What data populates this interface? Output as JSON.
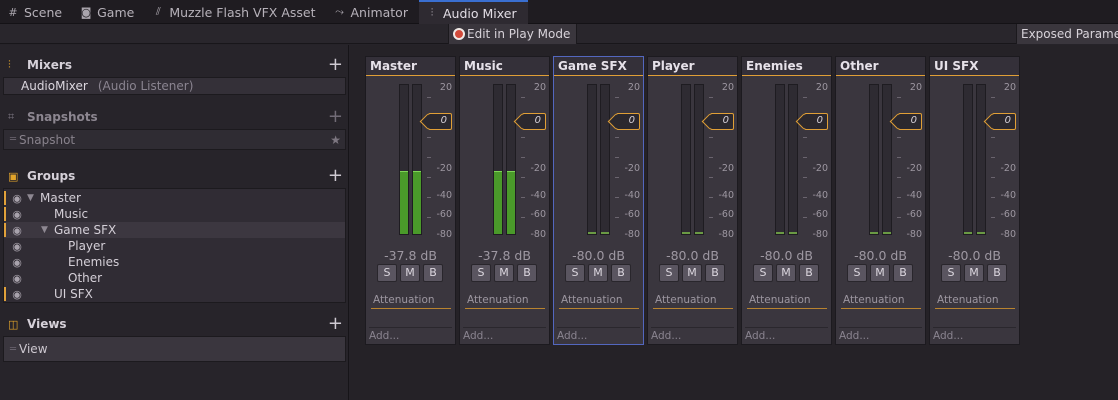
{
  "tabs": [
    {
      "label": "Scene",
      "icon": "grid-icon"
    },
    {
      "label": "Game",
      "icon": "gamepad-icon"
    },
    {
      "label": "Muzzle Flash VFX Asset",
      "icon": "vfx-icon"
    },
    {
      "label": "Animator",
      "icon": "animator-icon"
    },
    {
      "label": "Audio Mixer",
      "icon": "mixer-icon",
      "active": true
    }
  ],
  "toolbar": {
    "play_mode_label": "Edit in Play Mode",
    "exposed_label": "Exposed Paramet"
  },
  "left": {
    "mixers": {
      "title": "Mixers",
      "item_name": "AudioMixer",
      "item_sub": "(Audio Listener)"
    },
    "snapshots": {
      "title": "Snapshots",
      "item": "Snapshot"
    },
    "groups": {
      "title": "Groups",
      "items": [
        {
          "label": "Master",
          "expanded": true
        },
        {
          "label": "Music"
        },
        {
          "label": "Game SFX",
          "expanded": true
        },
        {
          "label": "Player"
        },
        {
          "label": "Enemies"
        },
        {
          "label": "Other"
        },
        {
          "label": "UI SFX"
        }
      ]
    },
    "views": {
      "title": "Views",
      "item": "View"
    }
  },
  "scale": [
    "20",
    "-20",
    "-40",
    "-60",
    "-80"
  ],
  "fader_value": "0",
  "strips": [
    {
      "name": "Master",
      "db": "-37.8 dB",
      "level_db": -37.8
    },
    {
      "name": "Music",
      "db": "-37.8 dB",
      "level_db": -37.8
    },
    {
      "name": "Game SFX",
      "db": "-80.0 dB",
      "level_db": -80.0,
      "selected": true
    },
    {
      "name": "Player",
      "db": "-80.0 dB",
      "level_db": -80.0
    },
    {
      "name": "Enemies",
      "db": "-80.0 dB",
      "level_db": -80.0
    },
    {
      "name": "Other",
      "db": "-80.0 dB",
      "level_db": -80.0
    },
    {
      "name": "UI SFX",
      "db": "-80.0 dB",
      "level_db": -80.0
    }
  ],
  "buttons": {
    "solo": "S",
    "mute": "M",
    "bypass": "B"
  },
  "attenuation_label": "Attenuation",
  "add_label": "Add...",
  "colors": {
    "accent": "#e09f36",
    "selection": "#5367bf",
    "meter": "#4a9a2a",
    "record": "#d24a3a"
  }
}
